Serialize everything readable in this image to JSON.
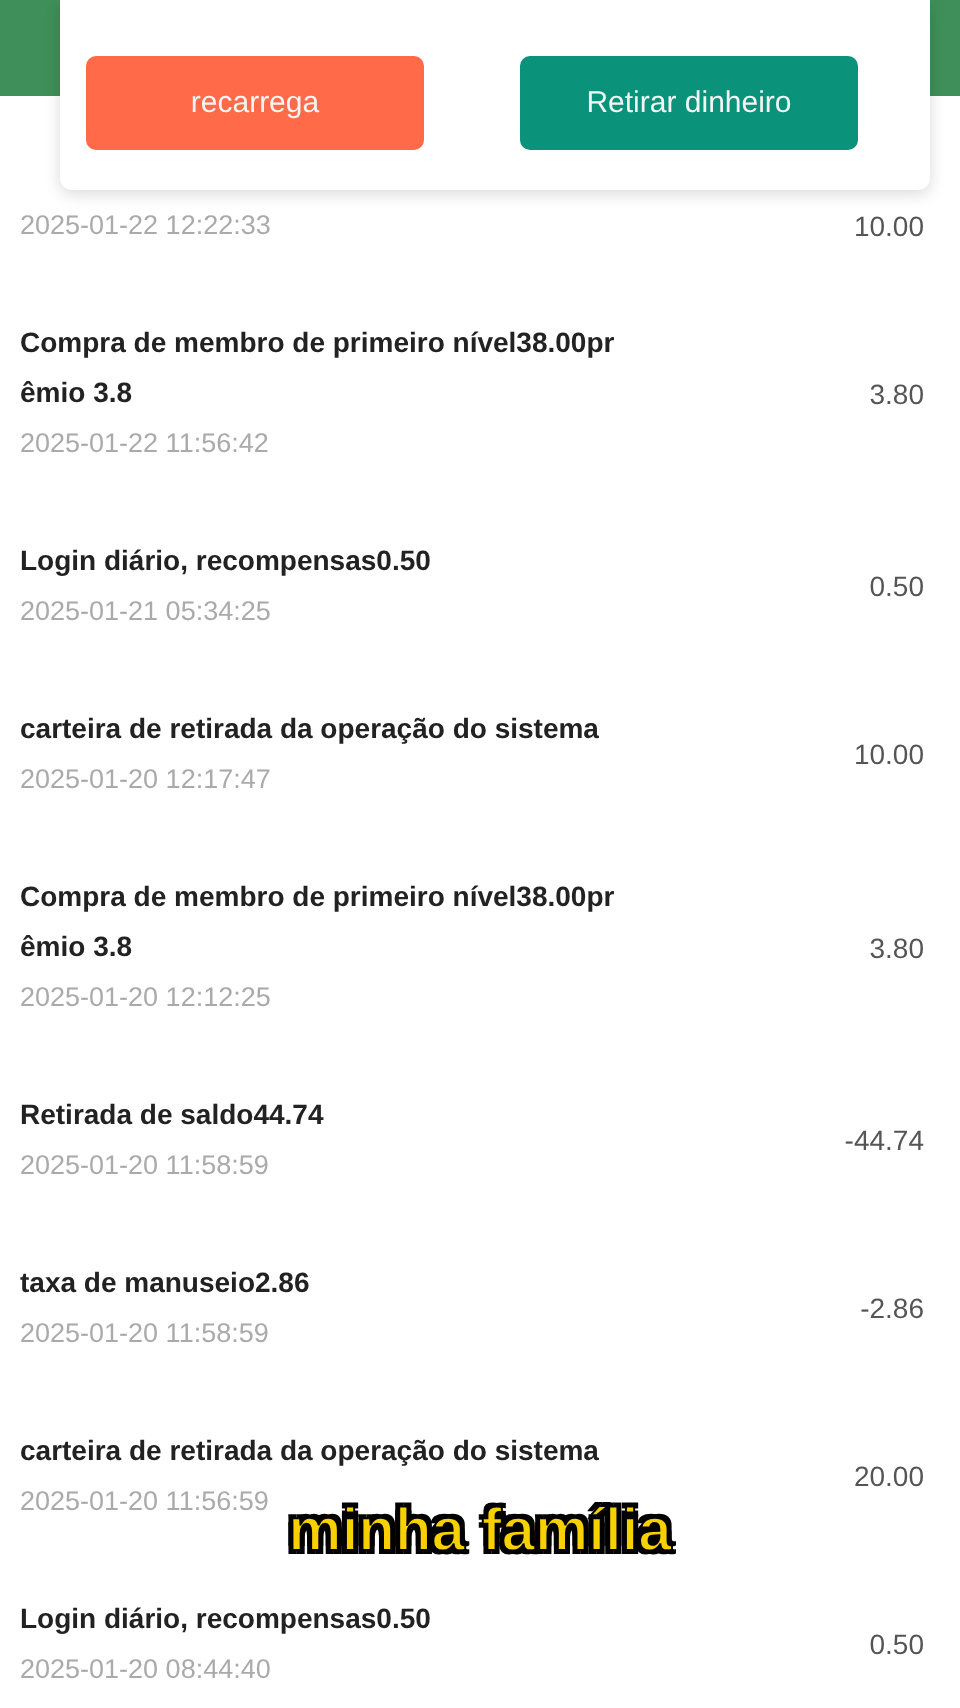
{
  "actions": [
    {
      "label": "recarrega",
      "kind": "recharge"
    },
    {
      "label": "Retirar dinheiro",
      "kind": "withdraw"
    }
  ],
  "records": [
    {
      "date": "2025-01-22 12:22:33",
      "amount": "10.00"
    },
    {
      "title": "Compra de membro de primeiro nível38.00prêmio 3.8",
      "date": "2025-01-22 11:56:42",
      "amount": "3.80"
    },
    {
      "title": "Login diário, recompensas0.50",
      "date": "2025-01-21 05:34:25",
      "amount": "0.50"
    },
    {
      "title": "carteira de retirada da operação do sistema",
      "date": "2025-01-20 12:17:47",
      "amount": "10.00"
    },
    {
      "title": "Compra de membro de primeiro nível38.00prêmio 3.8",
      "date": "2025-01-20 12:12:25",
      "amount": "3.80"
    },
    {
      "title": "Retirada de saldo44.74",
      "date": "2025-01-20 11:58:59",
      "amount": "-44.74"
    },
    {
      "title": "taxa de manuseio2.86",
      "date": "2025-01-20 11:58:59",
      "amount": "-2.86"
    },
    {
      "title": "carteira de retirada da operação do sistema",
      "date": "2025-01-20 11:56:59",
      "amount": "20.00"
    },
    {
      "title": "Login diário, recompensas0.50",
      "date": "2025-01-20 08:44:40",
      "amount": "0.50"
    }
  ],
  "caption": "minha família"
}
